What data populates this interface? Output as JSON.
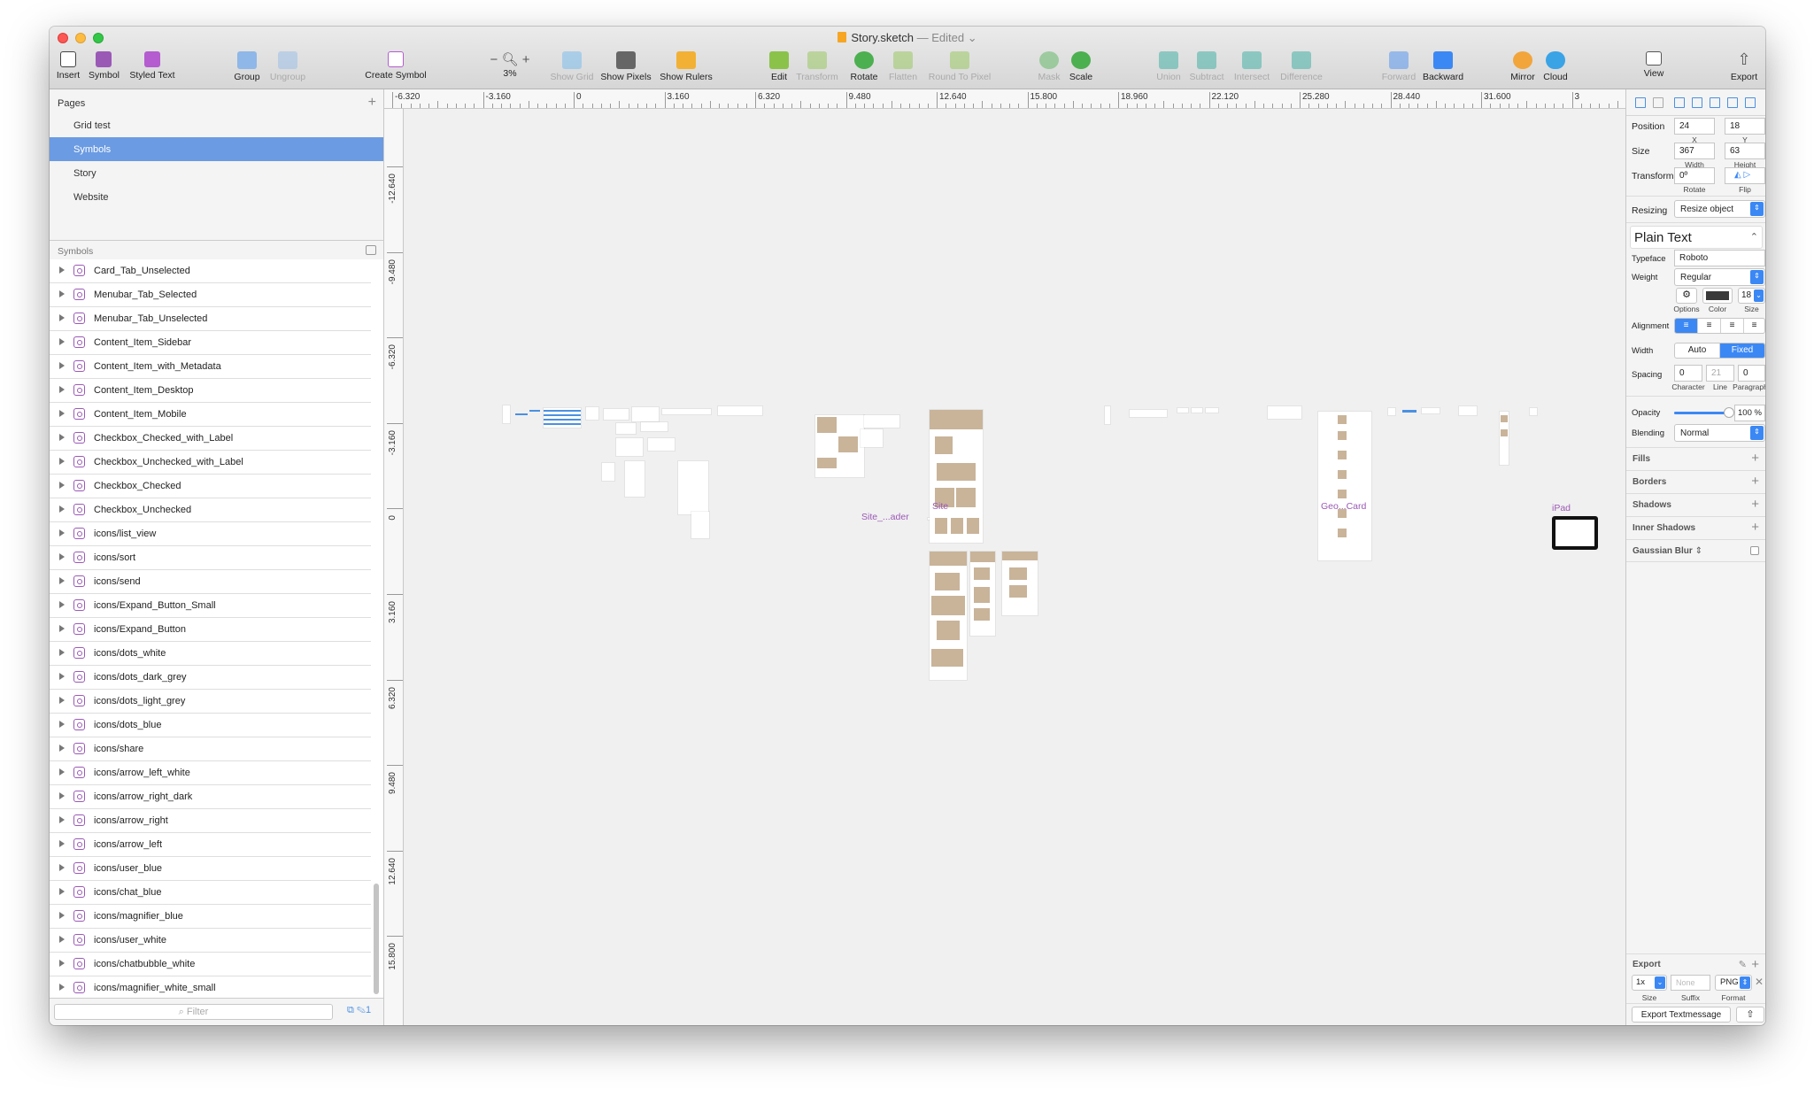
{
  "window": {
    "title": "Story.sketch",
    "status": "— Edited"
  },
  "toolbar": {
    "insert": "Insert",
    "symbol": "Symbol",
    "styled_text": "Styled Text",
    "group": "Group",
    "ungroup": "Ungroup",
    "create_symbol": "Create Symbol",
    "zoom_minus": "−",
    "zoom_plus": "+",
    "zoom": "3%",
    "show_grid": "Show Grid",
    "show_pixels": "Show Pixels",
    "show_rulers": "Show Rulers",
    "edit": "Edit",
    "transform": "Transform",
    "rotate": "Rotate",
    "flatten": "Flatten",
    "round_to_pixel": "Round To Pixel",
    "mask": "Mask",
    "scale": "Scale",
    "union": "Union",
    "subtract": "Subtract",
    "intersect": "Intersect",
    "difference": "Difference",
    "forward": "Forward",
    "backward": "Backward",
    "mirror": "Mirror",
    "cloud": "Cloud",
    "view": "View",
    "export": "Export"
  },
  "pages": {
    "header": "Pages",
    "add": "+",
    "items": [
      "Grid test",
      "Symbols",
      "Story",
      "Website"
    ],
    "selected": "Symbols"
  },
  "symbols": {
    "header": "Symbols",
    "layers": [
      "Card_Tab_Unselected",
      "Menubar_Tab_Selected",
      "Menubar_Tab_Unselected",
      "Content_Item_Sidebar",
      "Content_Item_with_Metadata",
      "Content_Item_Desktop",
      "Content_Item_Mobile",
      "Checkbox_Checked_with_Label",
      "Checkbox_Unchecked_with_Label",
      "Checkbox_Checked",
      "Checkbox_Unchecked",
      "icons/list_view",
      "icons/sort",
      "icons/send",
      "icons/Expand_Button_Small",
      "icons/Expand_Button",
      "icons/dots_white",
      "icons/dots_dark_grey",
      "icons/dots_light_grey",
      "icons/dots_blue",
      "icons/share",
      "icons/arrow_left_white",
      "icons/arrow_right_dark",
      "icons/arrow_right",
      "icons/arrow_left",
      "icons/user_blue",
      "icons/chat_blue",
      "icons/magnifier_blue",
      "icons/user_white",
      "icons/chatbubble_white",
      "icons/magnifier_white_small"
    ],
    "filter_placeholder": "Filter",
    "filter_count": "1"
  },
  "rulers": {
    "top": [
      "-6.320",
      "-3.160",
      "0",
      "3.160",
      "6.320",
      "9.480",
      "12.640",
      "15.800",
      "18.960",
      "22.120",
      "25.280",
      "28.440",
      "31.600",
      "3"
    ],
    "left": [
      "-12.640",
      "-9.480",
      "-6.320",
      "-3.160",
      "0",
      "3.160",
      "6.320",
      "9.480",
      "12.640",
      "15.800"
    ]
  },
  "canvas": {
    "artboard_labels": [
      "Site_...ader",
      "Site",
      "Geo...Card",
      "iPad"
    ]
  },
  "inspector": {
    "position_label": "Position",
    "x": "24",
    "y": "18",
    "x_label": "X",
    "y_label": "Y",
    "size_label": "Size",
    "width": "367",
    "height": "63",
    "width_label": "Width",
    "height_label": "Height",
    "transform_label": "Transform",
    "rotate": "0º",
    "rotate_label": "Rotate",
    "flip_label": "Flip",
    "resizing_label": "Resizing",
    "resizing_value": "Resize object",
    "text_style": "Plain Text",
    "typeface_label": "Typeface",
    "typeface": "Roboto",
    "weight_label": "Weight",
    "weight": "Regular",
    "options_label": "Options",
    "color_label": "Color",
    "font_size": "18",
    "size_small_label": "Size",
    "text_color": "#3a3a3a",
    "alignment_label": "Alignment",
    "width_mode_label": "Width",
    "width_auto": "Auto",
    "width_fixed": "Fixed",
    "spacing_label": "Spacing",
    "char_spacing": "0",
    "line_spacing": "21",
    "para_spacing": "0",
    "char_label": "Character",
    "line_label": "Line",
    "para_label": "Paragraph",
    "opacity_label": "Opacity",
    "opacity_value": "100 %",
    "opacity_fraction": 1.0,
    "blending_label": "Blending",
    "blending_value": "Normal",
    "fills": "Fills",
    "borders": "Borders",
    "shadows": "Shadows",
    "inner_shadows": "Inner Shadows",
    "gaussian_blur": "Gaussian Blur",
    "export_label": "Export",
    "export_scale": "1x",
    "export_suffix_placeholder": "None",
    "export_format": "PNG",
    "export_size_label": "Size",
    "export_suffix_label": "Suffix",
    "export_format_label": "Format",
    "export_button": "Export Textmessage"
  },
  "colors": {
    "accent": "#3b88f5",
    "selection": "#6b9be2",
    "symbol": "#9b59b6"
  }
}
